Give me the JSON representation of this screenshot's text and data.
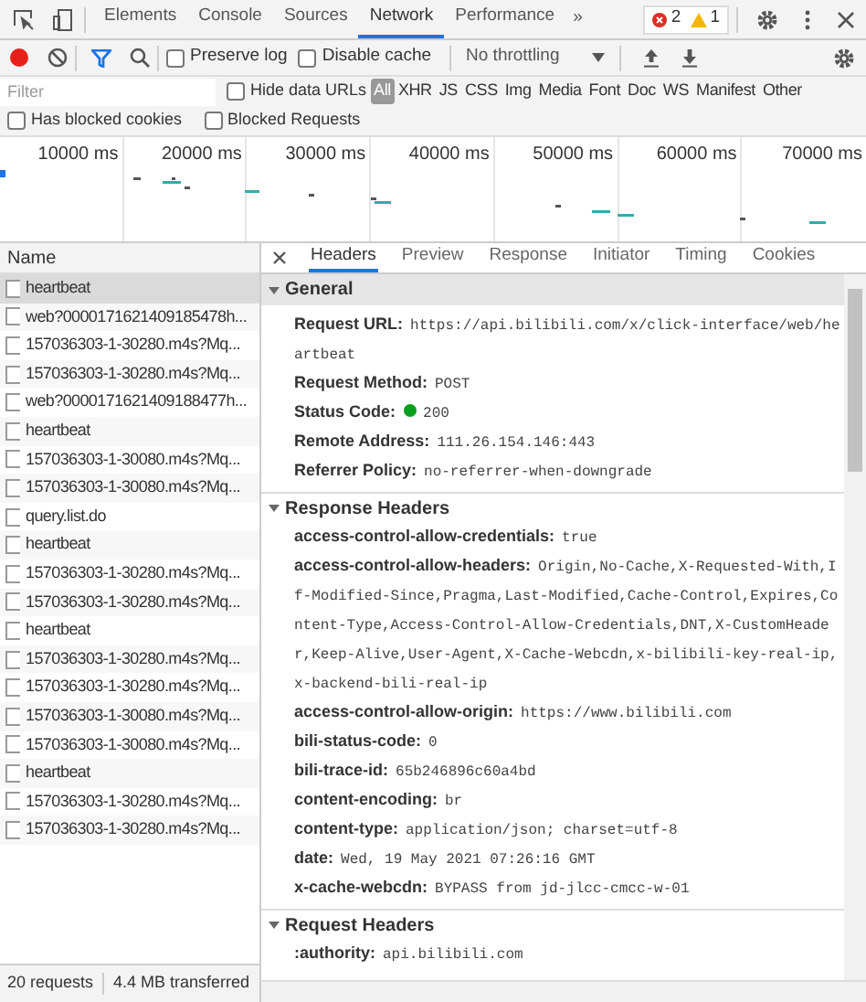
{
  "panel_tabs": [
    {
      "label": "Elements",
      "selected": false
    },
    {
      "label": "Console",
      "selected": false
    },
    {
      "label": "Sources",
      "selected": false
    },
    {
      "label": "Network",
      "selected": true
    },
    {
      "label": "Performance",
      "selected": false
    }
  ],
  "more_tabs": "»",
  "issues": {
    "errors": "2",
    "warnings": "1"
  },
  "toolbar": {
    "recording": true,
    "filter_active": true,
    "checkboxes": [
      {
        "label": "Preserve log",
        "checked": false
      },
      {
        "label": "Disable cache",
        "checked": false
      }
    ],
    "throttling": "No throttling"
  },
  "filter": {
    "placeholder": "Filter",
    "hide_data_urls": {
      "label": "Hide data URLs",
      "checked": false
    },
    "types": [
      {
        "label": "All",
        "selected": true
      },
      {
        "label": "XHR",
        "selected": false
      },
      {
        "label": "JS",
        "selected": false
      },
      {
        "label": "CSS",
        "selected": false
      },
      {
        "label": "Img",
        "selected": false
      },
      {
        "label": "Media",
        "selected": false
      },
      {
        "label": "Font",
        "selected": false
      },
      {
        "label": "Doc",
        "selected": false
      },
      {
        "label": "WS",
        "selected": false
      },
      {
        "label": "Manifest",
        "selected": false
      },
      {
        "label": "Other",
        "selected": false
      }
    ]
  },
  "blocked_filters": [
    {
      "label": "Has blocked cookies",
      "checked": false
    },
    {
      "label": "Blocked Requests",
      "checked": false
    }
  ],
  "timeline_ticks": [
    "10000 ms",
    "20000 ms",
    "30000 ms",
    "40000 ms",
    "50000 ms",
    "60000 ms",
    "70000 ms"
  ],
  "requests": {
    "column": "Name",
    "rows": [
      {
        "name": "heartbeat",
        "selected": true
      },
      {
        "name": "web?0000171621409185478h...",
        "selected": false
      },
      {
        "name": "157036303-1-30280.m4s?Mq...",
        "selected": false
      },
      {
        "name": "157036303-1-30280.m4s?Mq...",
        "selected": false
      },
      {
        "name": "web?0000171621409188477h...",
        "selected": false
      },
      {
        "name": "heartbeat",
        "selected": false
      },
      {
        "name": "157036303-1-30080.m4s?Mq...",
        "selected": false
      },
      {
        "name": "157036303-1-30080.m4s?Mq...",
        "selected": false
      },
      {
        "name": "query.list.do",
        "selected": false
      },
      {
        "name": "heartbeat",
        "selected": false
      },
      {
        "name": "157036303-1-30280.m4s?Mq...",
        "selected": false
      },
      {
        "name": "157036303-1-30280.m4s?Mq...",
        "selected": false
      },
      {
        "name": "heartbeat",
        "selected": false
      },
      {
        "name": "157036303-1-30280.m4s?Mq...",
        "selected": false
      },
      {
        "name": "157036303-1-30280.m4s?Mq...",
        "selected": false
      },
      {
        "name": "157036303-1-30080.m4s?Mq...",
        "selected": false
      },
      {
        "name": "157036303-1-30080.m4s?Mq...",
        "selected": false
      },
      {
        "name": "heartbeat",
        "selected": false
      },
      {
        "name": "157036303-1-30280.m4s?Mq...",
        "selected": false
      },
      {
        "name": "157036303-1-30280.m4s?Mq...",
        "selected": false
      }
    ]
  },
  "status_bar": {
    "requests": "20 requests",
    "transferred": "4.4 MB transferred"
  },
  "detail_tabs": [
    {
      "label": "Headers",
      "selected": true
    },
    {
      "label": "Preview",
      "selected": false
    },
    {
      "label": "Response",
      "selected": false
    },
    {
      "label": "Initiator",
      "selected": false
    },
    {
      "label": "Timing",
      "selected": false
    },
    {
      "label": "Cookies",
      "selected": false
    }
  ],
  "sections": [
    {
      "title": "General",
      "expanded": true,
      "rows": [
        {
          "kind": "text",
          "name": "Request URL:",
          "value": "https://api.bilibili.com/x/click-interface/web/heartbeat"
        },
        {
          "kind": "text",
          "name": "Request Method:",
          "value": "POST"
        },
        {
          "kind": "status",
          "name": "Status Code:",
          "value": "200"
        },
        {
          "kind": "text",
          "name": "Remote Address:",
          "value": "111.26.154.146:443"
        },
        {
          "kind": "text",
          "name": "Referrer Policy:",
          "value": "no-referrer-when-downgrade"
        }
      ]
    },
    {
      "title": "Response Headers",
      "expanded": true,
      "rows": [
        {
          "kind": "text",
          "name": "access-control-allow-credentials:",
          "value": "true"
        },
        {
          "kind": "text",
          "name": "access-control-allow-headers:",
          "value": "Origin,No-Cache,X-Requested-With,If-Modified-Since,Pragma,Last-Modified,Cache-Control,Expires,Content-Type,Access-Control-Allow-Credentials,DNT,X-CustomHeader,Keep-Alive,User-Agent,X-Cache-Webcdn,x-bilibili-key-real-ip,x-backend-bili-real-ip"
        },
        {
          "kind": "text",
          "name": "access-control-allow-origin:",
          "value": "https://www.bilibili.com"
        },
        {
          "kind": "text",
          "name": "bili-status-code:",
          "value": "0"
        },
        {
          "kind": "text",
          "name": "bili-trace-id:",
          "value": "65b246896c60a4bd"
        },
        {
          "kind": "text",
          "name": "content-encoding:",
          "value": "br"
        },
        {
          "kind": "text",
          "name": "content-type:",
          "value": "application/json; charset=utf-8"
        },
        {
          "kind": "text",
          "name": "date:",
          "value": "Wed, 19 May 2021 07:26:16 GMT"
        },
        {
          "kind": "text",
          "name": "x-cache-webcdn:",
          "value": "BYPASS from jd-jlcc-cmcc-w-01"
        }
      ]
    },
    {
      "title": "Request Headers",
      "expanded": true,
      "rows": [
        {
          "kind": "text",
          "name": ":authority:",
          "value": "api.bilibili.com"
        }
      ]
    }
  ]
}
